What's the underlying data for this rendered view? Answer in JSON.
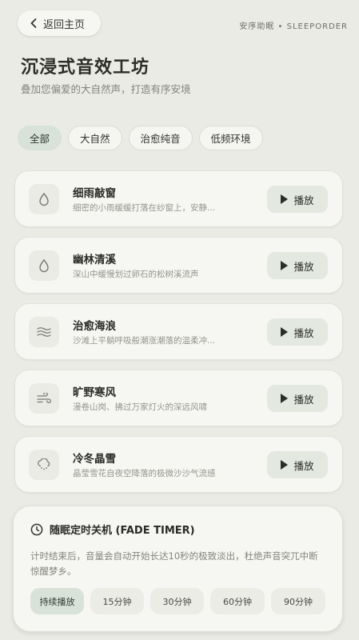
{
  "header": {
    "back_label": "返回主页",
    "brand": "安序助眠 • SLEEPORDER"
  },
  "page": {
    "title": "沉浸式音效工坊",
    "subtitle": "叠加您偏爱的大自然声，打造有序安境"
  },
  "filters": [
    "全部",
    "大自然",
    "治愈纯音",
    "低频环境"
  ],
  "active_filter": "全部",
  "tracks": [
    {
      "title": "细雨敲窗",
      "desc": "细密的小雨缓缓打落在纱窗上，安静...",
      "icon": "droplet-icon",
      "play_label": "播放"
    },
    {
      "title": "幽林清溪",
      "desc": "深山中缓慢划过卵石的松树溪流声",
      "icon": "droplet-icon",
      "play_label": "播放"
    },
    {
      "title": "治愈海浪",
      "desc": "沙滩上平躺呼吸般潮涨潮落的温柔冲...",
      "icon": "waves-icon",
      "play_label": "播放"
    },
    {
      "title": "旷野寒风",
      "desc": "漫卷山岗、拂过万家灯火的深远风啸",
      "icon": "wind-icon",
      "play_label": "播放"
    },
    {
      "title": "冷冬晶雪",
      "desc": "晶莹雪花自夜空降落的极微沙沙气流感",
      "icon": "snow-cloud-icon",
      "play_label": "播放"
    }
  ],
  "timer": {
    "title": "随眠定时关机 (FADE TIMER)",
    "description": "计时结束后，音量会自动开始长达10秒的极致淡出，杜绝声音突兀中断惊醒梦乡。",
    "options": [
      "持续播放",
      "15分钟",
      "30分钟",
      "60分钟",
      "90分钟"
    ],
    "selected": "持续播放"
  },
  "colors": {
    "background": "#ebebe6",
    "card": "#f6f6f3",
    "accent": "#d8e2d8",
    "text": "#2c2c28"
  }
}
